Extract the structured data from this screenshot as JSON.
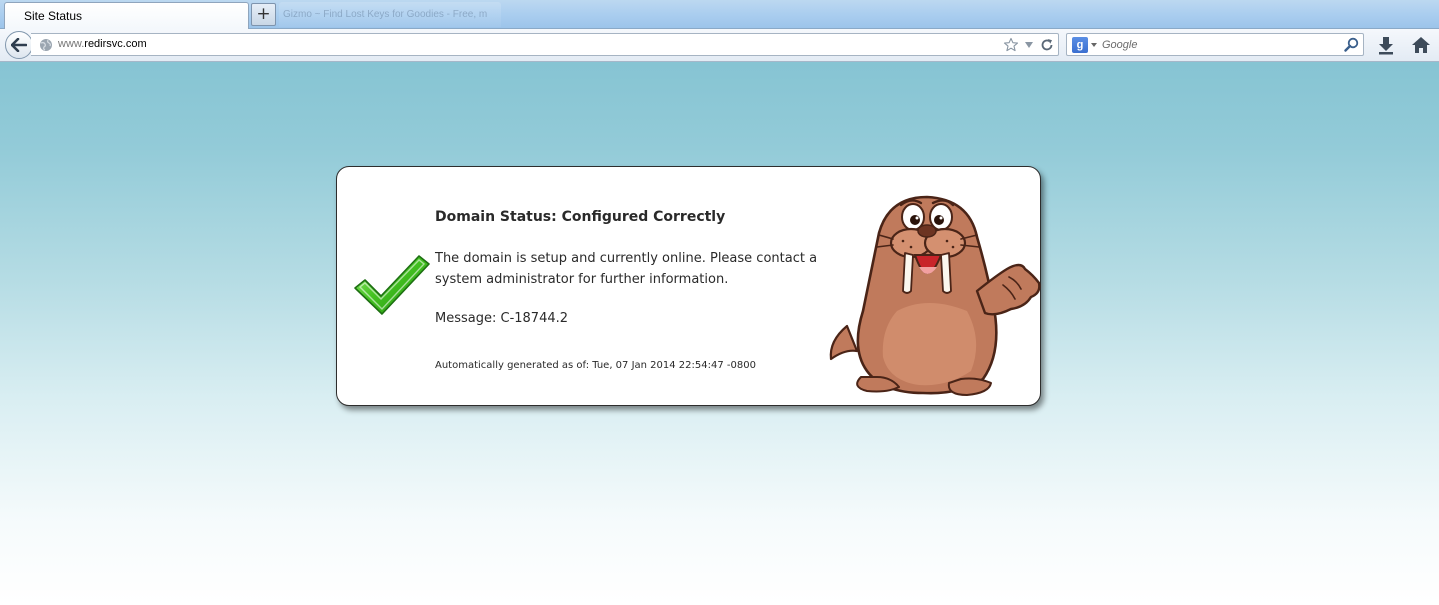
{
  "browser": {
    "active_tab_title": "Site Status",
    "new_tab_label": "+",
    "background_tab_title": "Gizmo ~ Find Lost Keys for Goodies - Free, m",
    "url_prefix": "www.",
    "url_host": "redirsvc.com",
    "search_engine_letter": "g",
    "search_placeholder": "Google"
  },
  "card": {
    "title": "Domain Status: Configured Correctly",
    "body": "The domain is setup and currently online. Please contact a system administrator for further information.",
    "message": "Message: C-18744.2",
    "generated": "Automatically generated as of: Tue, 07 Jan 2014 22:54:47 -0800"
  },
  "icons": {
    "back": "back-arrow-icon",
    "site": "globe-icon",
    "bookmark": "star-icon",
    "history": "dropmarker-icon",
    "reload": "reload-icon",
    "engine": "google-icon",
    "search_go": "magnifier-icon",
    "downloads": "download-arrow-icon",
    "home": "home-icon",
    "status": "green-checkmark-icon",
    "mascot": "walrus-mascot"
  },
  "colors": {
    "check_green": "#3fbf1f",
    "page_top": "#86c4d3",
    "mascot_body": "#c07a5c"
  }
}
